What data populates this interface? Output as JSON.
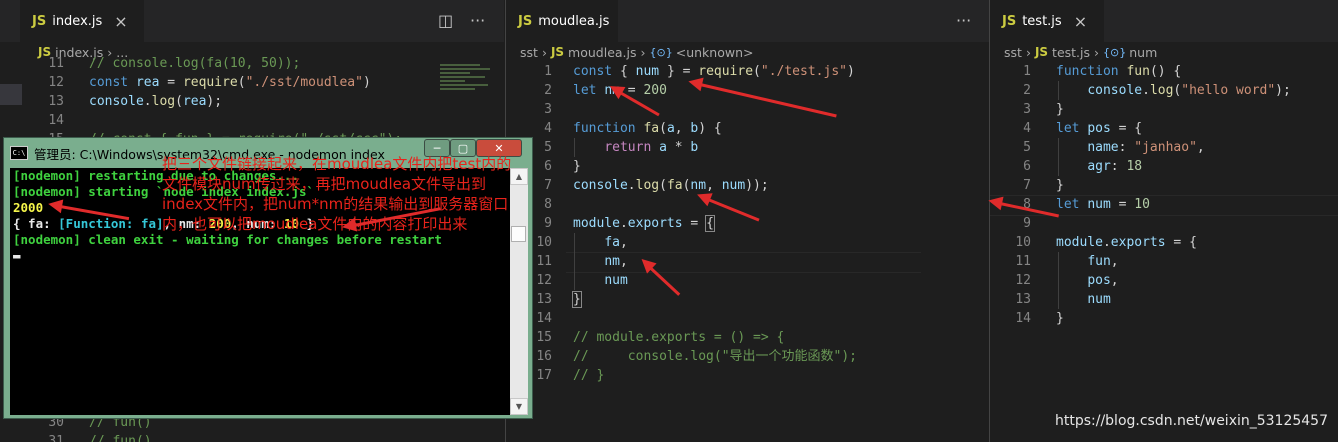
{
  "pane1": {
    "tab": {
      "badge": "JS",
      "label": "index.js",
      "close": "×"
    },
    "icons": {
      "split": "◫",
      "more": "···"
    },
    "breadcrumb": {
      "badge": "JS",
      "file": "index.js",
      "sep": "›",
      "rest": "..."
    },
    "lines": [
      {
        "n": "11",
        "html": "<span class='cm'>// console.log(fa(10, 50));</span>"
      },
      {
        "n": "12",
        "html": "<span class='kw'>const</span> <span class='vr'>rea</span> <span class='pl'>=</span> <span class='fn'>require</span><span class='pl'>(</span><span class='st'>\"./sst/moudlea\"</span><span class='pl'>)</span>"
      },
      {
        "n": "13",
        "html": "<span class='vr'>console</span><span class='pl'>.</span><span class='fn'>log</span><span class='pl'>(</span><span class='vr'>rea</span><span class='pl'>);</span>"
      },
      {
        "n": "14",
        "html": ""
      },
      {
        "n": "15",
        "html": "<span class='cm'>// const { fun } = require(\"./sst/ccc\");</span>"
      }
    ],
    "bottom_lines": [
      {
        "n": "30",
        "html": "<span class='cm'>// fun()</span>"
      },
      {
        "n": "31",
        "html": "<span class='cm'>// fun()</span>"
      }
    ]
  },
  "pane2": {
    "tab": {
      "badge": "JS",
      "label": "moudlea.js"
    },
    "icons": {
      "more": "···"
    },
    "breadcrumb": {
      "folder": "sst",
      "sep": "›",
      "badge": "JS",
      "file": "moudlea.js",
      "symbol_icon": "{⊙}",
      "symbol": "<unknown>"
    },
    "lines": [
      {
        "n": "1",
        "html": "<span class='kw'>const</span> <span class='pl'>{</span> <span class='vr'>num</span> <span class='pl'>}</span> <span class='pl'>=</span> <span class='fn'>require</span><span class='pl'>(</span><span class='st'>\"./test.js\"</span><span class='pl'>)</span>"
      },
      {
        "n": "2",
        "html": "<span class='kw'>let</span> <span class='vr'>nm</span> <span class='pl'>=</span> <span class='nm'>200</span>"
      },
      {
        "n": "3",
        "html": ""
      },
      {
        "n": "4",
        "html": "<span class='kw'>function</span> <span class='fn'>fa</span><span class='pl'>(</span><span class='vr'>a</span><span class='pl'>,</span> <span class='vr'>b</span><span class='pl'>) {</span>"
      },
      {
        "n": "5",
        "html": "    <span class='kw2'>return</span> <span class='vr'>a</span> <span class='pl'>*</span> <span class='vr'>b</span>"
      },
      {
        "n": "6",
        "html": "<span class='pl'>}</span>"
      },
      {
        "n": "7",
        "html": "<span class='vr'>console</span><span class='pl'>.</span><span class='fn'>log</span><span class='pl'>(</span><span class='fn'>fa</span><span class='pl'>(</span><span class='vr'>nm</span><span class='pl'>,</span> <span class='vr'>num</span><span class='pl'>));</span>"
      },
      {
        "n": "8",
        "html": ""
      },
      {
        "n": "9",
        "html": "<span class='vr'>module</span><span class='pl'>.</span><span class='vr'>exports</span> <span class='pl'>=</span> <span class='pl' style='outline:1px solid #888'>{</span>"
      },
      {
        "n": "10",
        "html": "    <span class='vr'>fa</span><span class='pl'>,</span>"
      },
      {
        "n": "11",
        "html": "    <span class='vr'>nm</span><span class='pl'>,</span>"
      },
      {
        "n": "12",
        "html": "    <span class='vr'>num</span>"
      },
      {
        "n": "13",
        "html": "<span class='pl' style='outline:1px solid #888'>}</span>"
      },
      {
        "n": "14",
        "html": ""
      },
      {
        "n": "15",
        "html": "<span class='cm'>// module.exports = () =&gt; {</span>"
      },
      {
        "n": "16",
        "html": "<span class='cm'>//     console.log(\"导出一个功能函数\");</span>"
      },
      {
        "n": "17",
        "html": "<span class='cm'>// }</span>"
      }
    ]
  },
  "pane3": {
    "tab": {
      "badge": "JS",
      "label": "test.js",
      "close": "×"
    },
    "breadcrumb": {
      "folder": "sst",
      "sep": "›",
      "badge": "JS",
      "file": "test.js",
      "symbol_icon": "{⊙}",
      "symbol": "num"
    },
    "lines": [
      {
        "n": "1",
        "html": "<span class='kw'>function</span> <span class='fn'>fun</span><span class='pl'>() {</span>"
      },
      {
        "n": "2",
        "html": "    <span class='vr'>console</span><span class='pl'>.</span><span class='fn'>log</span><span class='pl'>(</span><span class='st'>\"hello word\"</span><span class='pl'>);</span>"
      },
      {
        "n": "3",
        "html": "<span class='pl'>}</span>"
      },
      {
        "n": "4",
        "html": "<span class='kw'>let</span> <span class='vr'>pos</span> <span class='pl'>= {</span>"
      },
      {
        "n": "5",
        "html": "    <span class='vr'>name</span><span class='pl'>:</span> <span class='st'>\"janhao\"</span><span class='pl'>,</span>"
      },
      {
        "n": "6",
        "html": "    <span class='vr'>agr</span><span class='pl'>:</span> <span class='nm'>18</span>"
      },
      {
        "n": "7",
        "html": "<span class='pl'>}</span>"
      },
      {
        "n": "8",
        "html": "<span class='kw'>let</span> <span class='vr'>num</span> <span class='pl'>=</span> <span class='nm'>10</span>"
      },
      {
        "n": "9",
        "html": ""
      },
      {
        "n": "10",
        "html": "<span class='vr'>module</span><span class='pl'>.</span><span class='vr'>exports</span> <span class='pl'>= {</span>"
      },
      {
        "n": "11",
        "html": "    <span class='vr'>fun</span><span class='pl'>,</span>"
      },
      {
        "n": "12",
        "html": "    <span class='vr'>pos</span><span class='pl'>,</span>"
      },
      {
        "n": "13",
        "html": "    <span class='vr'>num</span>"
      },
      {
        "n": "14",
        "html": "<span class='pl'>}</span>"
      }
    ]
  },
  "cmd": {
    "title": "管理员: C:\\Windows\\system32\\cmd.exe - nodemon  index",
    "icon_text": "C:\\",
    "buttons": {
      "minimize": "─",
      "maximize": "▢",
      "close": "✕"
    },
    "lines": [
      {
        "text": "[nodemon] restarting due to changes...",
        "color": "#3fd23f"
      },
      {
        "text": "[nodemon] starting `node index index.js`",
        "color": "#3fd23f"
      },
      {
        "text": "2000",
        "color": "#f5f54a"
      },
      {
        "html": "<span style='color:#e8e8e8'>{ fa: </span><span style='color:#35c8d8'>[Function: fa]</span><span style='color:#e8e8e8'>, nm: </span><span style='color:#f5f54a'>200</span><span style='color:#e8e8e8'>, num: </span><span style='color:#f5f54a'>10</span><span style='color:#e8e8e8'> }</span>"
      },
      {
        "text": "[nodemon] clean exit - waiting for changes before restart",
        "color": "#3fd23f"
      },
      {
        "text": "▬",
        "color": "#e8e8e8"
      }
    ],
    "scroll_up": "▲",
    "scroll_down": "▼"
  },
  "annotation": "把三个文件链接起来，在moudlea文件内把test内的文件模块num传过来，再把moudlea文件导出到index文件内，把num*nm的结果输出到服务器窗口内，也可以把moudlea文件内的内容打印出来",
  "watermark": "https://blog.csdn.net/weixin_53125457",
  "colors": {
    "arrow": "#e02b2b",
    "keyword": "#569cd6",
    "string": "#ce9178",
    "number": "#b5cea8",
    "comment": "#6a9955"
  }
}
